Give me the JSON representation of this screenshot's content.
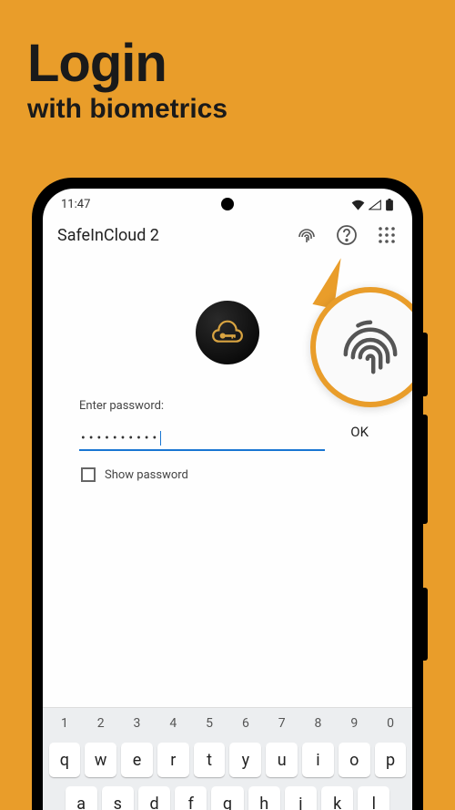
{
  "hero": {
    "title": "Login",
    "subtitle": "with biometrics"
  },
  "status": {
    "time": "11:47"
  },
  "appbar": {
    "title": "SafeInCloud 2"
  },
  "form": {
    "label": "Enter password:",
    "masked_value": "••••••••••",
    "ok_label": "OK",
    "show_pw_label": "Show password"
  },
  "keyboard": {
    "nums": [
      "1",
      "2",
      "3",
      "4",
      "5",
      "6",
      "7",
      "8",
      "9",
      "0"
    ],
    "row1": [
      "q",
      "w",
      "e",
      "r",
      "t",
      "y",
      "u",
      "i",
      "o",
      "p"
    ],
    "row2": [
      "a",
      "s",
      "d",
      "f",
      "g",
      "h",
      "j",
      "k",
      "l"
    ]
  }
}
